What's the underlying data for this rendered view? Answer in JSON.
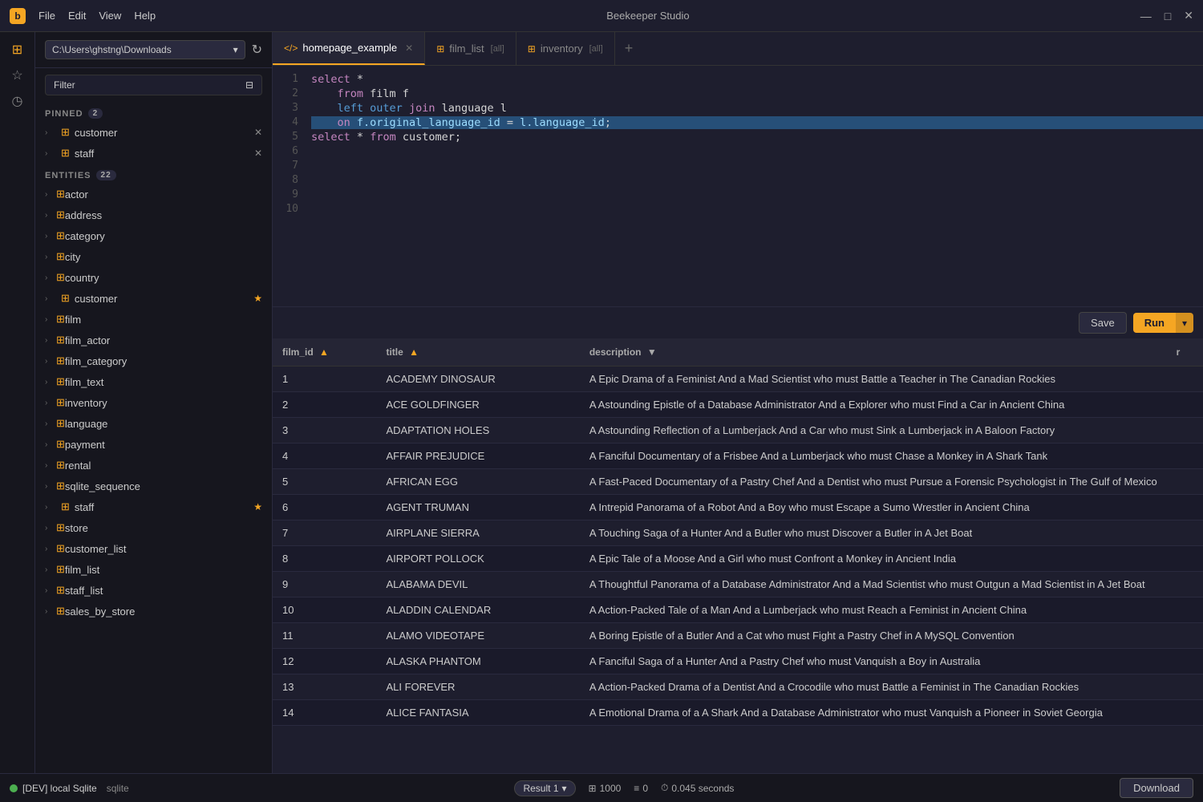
{
  "app": {
    "title": "Beekeeper Studio",
    "connection": "C:\\Users\\ghstng\\Downloads",
    "filter_placeholder": "Filter",
    "filter_icon": "⊟"
  },
  "titlebar": {
    "menus": [
      "File",
      "Edit",
      "View",
      "Help"
    ],
    "window_btns": [
      "—",
      "□",
      "✕"
    ]
  },
  "sidebar": {
    "pinned_label": "PINNED",
    "pinned_count": "2",
    "entities_label": "ENTITIES",
    "entities_count": "22",
    "pinned_items": [
      {
        "name": "customer",
        "starred": false
      },
      {
        "name": "staff",
        "starred": false
      }
    ],
    "entities": [
      {
        "name": "actor"
      },
      {
        "name": "address"
      },
      {
        "name": "category"
      },
      {
        "name": "city"
      },
      {
        "name": "country"
      },
      {
        "name": "customer",
        "starred": true
      },
      {
        "name": "film"
      },
      {
        "name": "film_actor"
      },
      {
        "name": "film_category"
      },
      {
        "name": "film_text"
      },
      {
        "name": "inventory"
      },
      {
        "name": "language"
      },
      {
        "name": "payment"
      },
      {
        "name": "rental"
      },
      {
        "name": "sqlite_sequence"
      },
      {
        "name": "staff",
        "starred": true
      },
      {
        "name": "store"
      },
      {
        "name": "customer_list"
      },
      {
        "name": "film_list"
      },
      {
        "name": "staff_list"
      },
      {
        "name": "sales_by_store"
      }
    ]
  },
  "tabs": [
    {
      "id": "homepage_example",
      "label": "homepage_example",
      "type": "query",
      "active": true
    },
    {
      "id": "film_list",
      "label": "film_list",
      "tag": "[all]",
      "type": "table"
    },
    {
      "id": "inventory",
      "label": "inventory",
      "tag": "[all]",
      "type": "table"
    }
  ],
  "editor": {
    "lines": [
      {
        "num": 1,
        "code": "select *"
      },
      {
        "num": 2,
        "code": "    from film f"
      },
      {
        "num": 3,
        "code": "    left outer join language l"
      },
      {
        "num": 4,
        "code": "    on f.original_language_id = l.language_id;"
      },
      {
        "num": 5,
        "code": "select * from customer;"
      },
      {
        "num": 6,
        "code": ""
      },
      {
        "num": 7,
        "code": ""
      },
      {
        "num": 8,
        "code": ""
      },
      {
        "num": 9,
        "code": ""
      },
      {
        "num": 10,
        "code": ""
      }
    ],
    "save_label": "Save",
    "run_label": "Run"
  },
  "results": {
    "columns": [
      {
        "id": "film_id",
        "label": "film_id",
        "sorted": "asc"
      },
      {
        "id": "title",
        "label": "title",
        "sorted": "asc"
      },
      {
        "id": "description",
        "label": "description",
        "sorted": "desc"
      },
      {
        "id": "r",
        "label": "r"
      }
    ],
    "rows": [
      {
        "film_id": "1",
        "title": "ACADEMY DINOSAUR",
        "description": "A Epic Drama of a Feminist And a Mad Scientist who must Battle a Teacher in The Canadian Rockies"
      },
      {
        "film_id": "2",
        "title": "ACE GOLDFINGER",
        "description": "A Astounding Epistle of a Database Administrator And a Explorer who must Find a Car in Ancient China"
      },
      {
        "film_id": "3",
        "title": "ADAPTATION HOLES",
        "description": "A Astounding Reflection of a Lumberjack And a Car who must Sink a Lumberjack in A Baloon Factory"
      },
      {
        "film_id": "4",
        "title": "AFFAIR PREJUDICE",
        "description": "A Fanciful Documentary of a Frisbee And a Lumberjack who must Chase a Monkey in A Shark Tank"
      },
      {
        "film_id": "5",
        "title": "AFRICAN EGG",
        "description": "A Fast-Paced Documentary of a Pastry Chef And a Dentist who must Pursue a Forensic Psychologist in The Gulf of Mexico"
      },
      {
        "film_id": "6",
        "title": "AGENT TRUMAN",
        "description": "A Intrepid Panorama of a Robot And a Boy who must Escape a Sumo Wrestler in Ancient China"
      },
      {
        "film_id": "7",
        "title": "AIRPLANE SIERRA",
        "description": "A Touching Saga of a Hunter And a Butler who must Discover a Butler in A Jet Boat"
      },
      {
        "film_id": "8",
        "title": "AIRPORT POLLOCK",
        "description": "A Epic Tale of a Moose And a Girl who must Confront a Monkey in Ancient India"
      },
      {
        "film_id": "9",
        "title": "ALABAMA DEVIL",
        "description": "A Thoughtful Panorama of a Database Administrator And a Mad Scientist who must Outgun a Mad Scientist in A Jet Boat"
      },
      {
        "film_id": "10",
        "title": "ALADDIN CALENDAR",
        "description": "A Action-Packed Tale of a Man And a Lumberjack who must Reach a Feminist in Ancient China"
      },
      {
        "film_id": "11",
        "title": "ALAMO VIDEOTAPE",
        "description": "A Boring Epistle of a Butler And a Cat who must Fight a Pastry Chef in A MySQL Convention"
      },
      {
        "film_id": "12",
        "title": "ALASKA PHANTOM",
        "description": "A Fanciful Saga of a Hunter And a Pastry Chef who must Vanquish a Boy in Australia"
      },
      {
        "film_id": "13",
        "title": "ALI FOREVER",
        "description": "A Action-Packed Drama of a Dentist And a Crocodile who must Battle a Feminist in The Canadian Rockies"
      },
      {
        "film_id": "14",
        "title": "ALICE FANTASIA",
        "description": "A Emotional Drama of a A Shark And a Database Administrator who must Vanquish a Pioneer in Soviet Georgia"
      }
    ]
  },
  "statusbar": {
    "indicator_label": "[DEV] local Sqlite",
    "db_type": "sqlite",
    "result_label": "Result 1",
    "row_count": "1000",
    "null_count": "0",
    "query_time": "0.045 seconds",
    "download_label": "Download"
  }
}
